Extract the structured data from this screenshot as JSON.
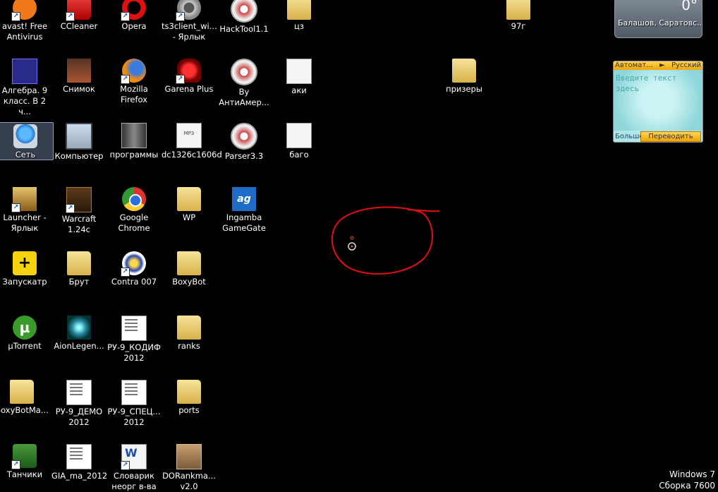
{
  "desktop": {
    "icons": [
      {
        "label": "avast! Free Antivirus"
      },
      {
        "label": "CCleaner"
      },
      {
        "label": "Opera"
      },
      {
        "label": "ts3client_wi... - Ярлык"
      },
      {
        "label": "HackTool1.1"
      },
      {
        "label": "цз"
      },
      {
        "label": "97г"
      },
      {
        "label": "Алгебра. 9 класс. В 2 ч..."
      },
      {
        "label": "Снимок"
      },
      {
        "label": "Mozilla Firefox"
      },
      {
        "label": "Garena Plus"
      },
      {
        "label": "By АнтиАмер..."
      },
      {
        "label": "аки"
      },
      {
        "label": "призеры"
      },
      {
        "label": "Сеть"
      },
      {
        "label": "Компьютер"
      },
      {
        "label": "программы"
      },
      {
        "label": "dc1326c1606d"
      },
      {
        "label": "Parser3.3"
      },
      {
        "label": "баго"
      },
      {
        "label": "Launcher - Ярлык"
      },
      {
        "label": "Warcraft 1.24c"
      },
      {
        "label": "Google Chrome"
      },
      {
        "label": "WP"
      },
      {
        "label": "Ingamba GameGate"
      },
      {
        "label": "Запускатр"
      },
      {
        "label": "Брут"
      },
      {
        "label": "Contra 007"
      },
      {
        "label": "BoxyBot"
      },
      {
        "label": "µTorrent"
      },
      {
        "label": "AionLegen..."
      },
      {
        "label": "РУ-9_КОДИФ 2012"
      },
      {
        "label": "ranks"
      },
      {
        "label": "BoxyBotMa..."
      },
      {
        "label": "РУ-9_ДЕМО 2012"
      },
      {
        "label": "РУ-9_СПЕЦ... 2012"
      },
      {
        "label": "ports"
      },
      {
        "label": "Танчики"
      },
      {
        "label": "GIA_ma_2012"
      },
      {
        "label": "Словарик неорг в-ва"
      },
      {
        "label": "DORankma... v2.0"
      }
    ],
    "icon_glyphs": {
      "ingamba": "ag",
      "utorrent": "µ",
      "zapusk": "+",
      "mp3": "MP3",
      "shortcut_arrow": "↗"
    }
  },
  "weather_gadget": {
    "temp": "0°",
    "city": "Балашов, Саратовс..."
  },
  "translator_gadget": {
    "mode": "Автомат...",
    "arrow": "►",
    "language": "Русский",
    "placeholder_line1": "Введите текст",
    "placeholder_line2": "здесь",
    "more": "Больше",
    "button": "Переводить"
  },
  "watermark": {
    "line1": "Windows 7",
    "line2": "Сборка 7600"
  },
  "colors": {
    "annotation": "#e01010",
    "background": "#000000",
    "folder": "#e8c96a"
  }
}
